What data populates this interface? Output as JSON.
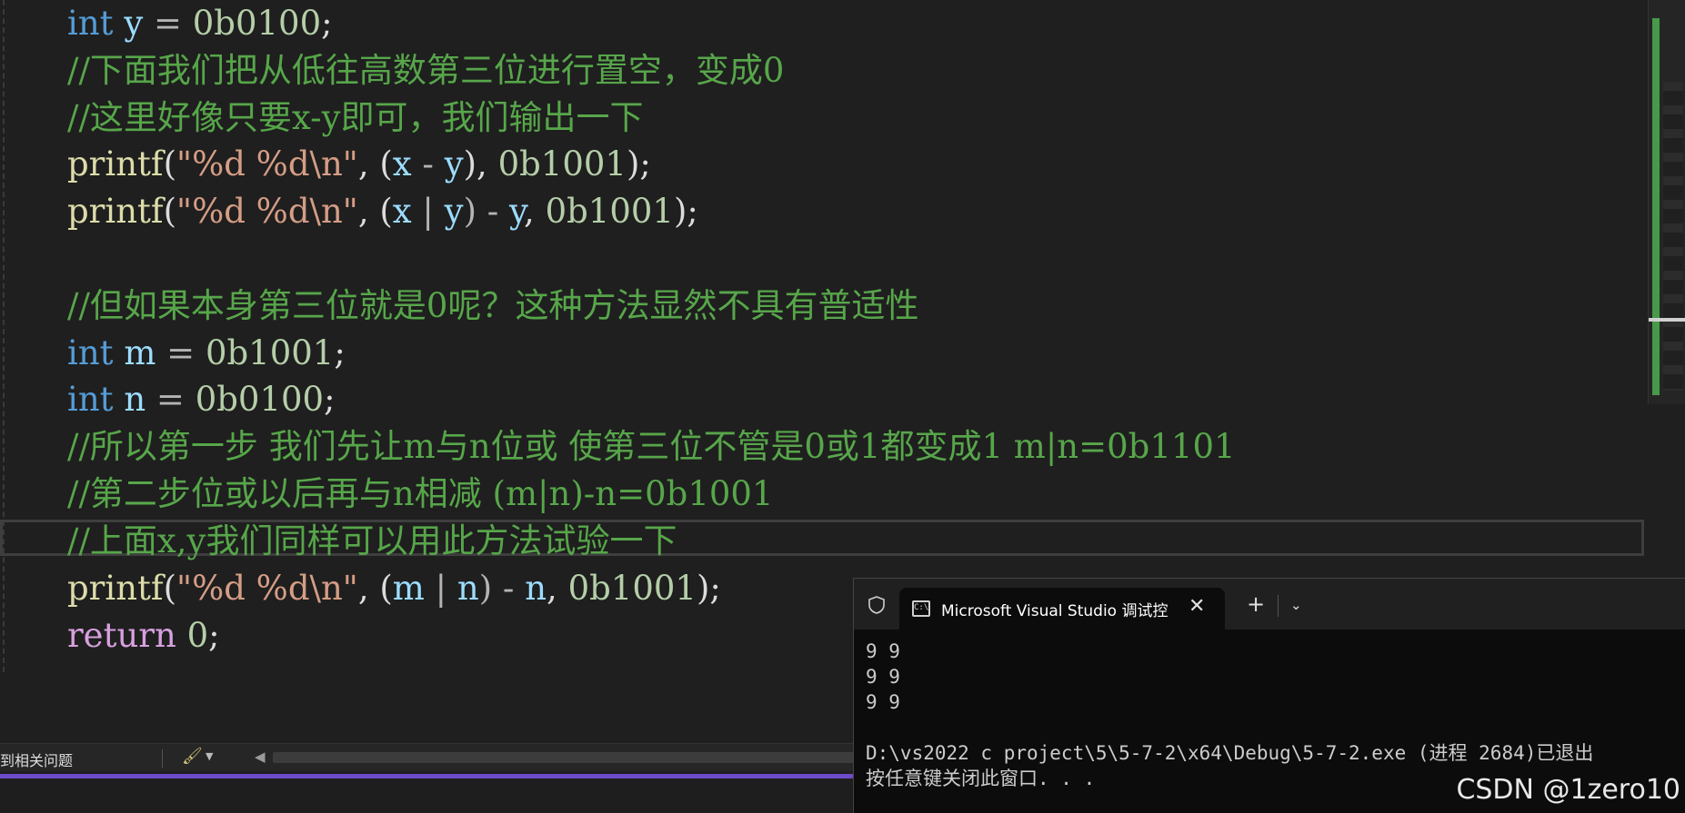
{
  "editor": {
    "code_lines": [
      [
        {
          "t": "int",
          "c": "kw"
        },
        {
          "t": " ",
          "c": ""
        },
        {
          "t": "y",
          "c": "var"
        },
        {
          "t": " = ",
          "c": "op"
        },
        {
          "t": "0b0100",
          "c": "num"
        },
        {
          "t": ";",
          "c": ""
        }
      ],
      [
        {
          "t": "//下面我们把从低往高数第三位进行置空，变成0",
          "c": "cmt"
        }
      ],
      [
        {
          "t": "//这里好像只要x-y即可，我们输出一下",
          "c": "cmt"
        }
      ],
      [
        {
          "t": "printf",
          "c": "fn"
        },
        {
          "t": "(",
          "c": ""
        },
        {
          "t": "\"%d %d\\n\"",
          "c": "str"
        },
        {
          "t": ", (",
          "c": ""
        },
        {
          "t": "x",
          "c": "var"
        },
        {
          "t": " - ",
          "c": "op"
        },
        {
          "t": "y",
          "c": "var"
        },
        {
          "t": "), ",
          "c": ""
        },
        {
          "t": "0b1001",
          "c": "num"
        },
        {
          "t": ");",
          "c": ""
        }
      ],
      [
        {
          "t": "printf",
          "c": "fn"
        },
        {
          "t": "(",
          "c": ""
        },
        {
          "t": "\"%d %d\\n\"",
          "c": "str"
        },
        {
          "t": ", (",
          "c": ""
        },
        {
          "t": "x",
          "c": "var"
        },
        {
          "t": " | ",
          "c": "op"
        },
        {
          "t": "y",
          "c": "var"
        },
        {
          "t": ") - ",
          "c": "op"
        },
        {
          "t": "y",
          "c": "var"
        },
        {
          "t": ", ",
          "c": ""
        },
        {
          "t": "0b1001",
          "c": "num"
        },
        {
          "t": ");",
          "c": ""
        }
      ],
      [],
      [
        {
          "t": "//但如果本身第三位就是0呢？这种方法显然不具有普适性",
          "c": "cmt"
        }
      ],
      [
        {
          "t": "int",
          "c": "kw"
        },
        {
          "t": " ",
          "c": ""
        },
        {
          "t": "m",
          "c": "var"
        },
        {
          "t": " = ",
          "c": "op"
        },
        {
          "t": "0b1001",
          "c": "num"
        },
        {
          "t": ";",
          "c": ""
        }
      ],
      [
        {
          "t": "int",
          "c": "kw"
        },
        {
          "t": " ",
          "c": ""
        },
        {
          "t": "n",
          "c": "var"
        },
        {
          "t": " = ",
          "c": "op"
        },
        {
          "t": "0b0100",
          "c": "num"
        },
        {
          "t": ";",
          "c": ""
        }
      ],
      [
        {
          "t": "//所以第一步 我们先让m与n位或 使第三位不管是0或1都变成1 m|n=0b1101",
          "c": "cmt"
        }
      ],
      [
        {
          "t": "//第二步位或以后再与n相减 (m|n)-n=0b1001",
          "c": "cmt"
        }
      ],
      [
        {
          "t": "//上面x,y我们同样可以用此方法试验一下",
          "c": "cmt"
        }
      ],
      [
        {
          "t": "printf",
          "c": "fn"
        },
        {
          "t": "(",
          "c": ""
        },
        {
          "t": "\"%d %d\\n\"",
          "c": "str"
        },
        {
          "t": ", (",
          "c": ""
        },
        {
          "t": "m",
          "c": "var"
        },
        {
          "t": " | ",
          "c": "op"
        },
        {
          "t": "n",
          "c": "var"
        },
        {
          "t": ") - ",
          "c": "op"
        },
        {
          "t": "n",
          "c": "var"
        },
        {
          "t": ", ",
          "c": ""
        },
        {
          "t": "0b1001",
          "c": "num"
        },
        {
          "t": ");",
          "c": ""
        }
      ],
      [
        {
          "t": "return",
          "c": "kw2"
        },
        {
          "t": " ",
          "c": ""
        },
        {
          "t": "0",
          "c": "num"
        },
        {
          "t": ";",
          "c": ""
        }
      ]
    ]
  },
  "statusbar": {
    "issues_text": "到相关问题"
  },
  "console": {
    "tab_title": "Microsoft Visual Studio 调试控",
    "tab_icon_text": "C:\\",
    "close_glyph": "✕",
    "new_tab_glyph": "+",
    "dropdown_glyph": "⌄",
    "output_lines": [
      "9 9",
      "9 9",
      "9 9",
      "",
      "D:\\vs2022 c project\\5\\5-7-2\\x64\\Debug\\5-7-2.exe (进程 2684)已退出",
      "按任意键关闭此窗口. . ."
    ]
  },
  "watermark": "CSDN @1zero10",
  "colors": {
    "keyword": "#569cd6",
    "comment": "#57a64a",
    "function": "#dcdcaa",
    "string": "#d69d85",
    "number": "#b5cea8",
    "variable": "#9cdcfe"
  }
}
